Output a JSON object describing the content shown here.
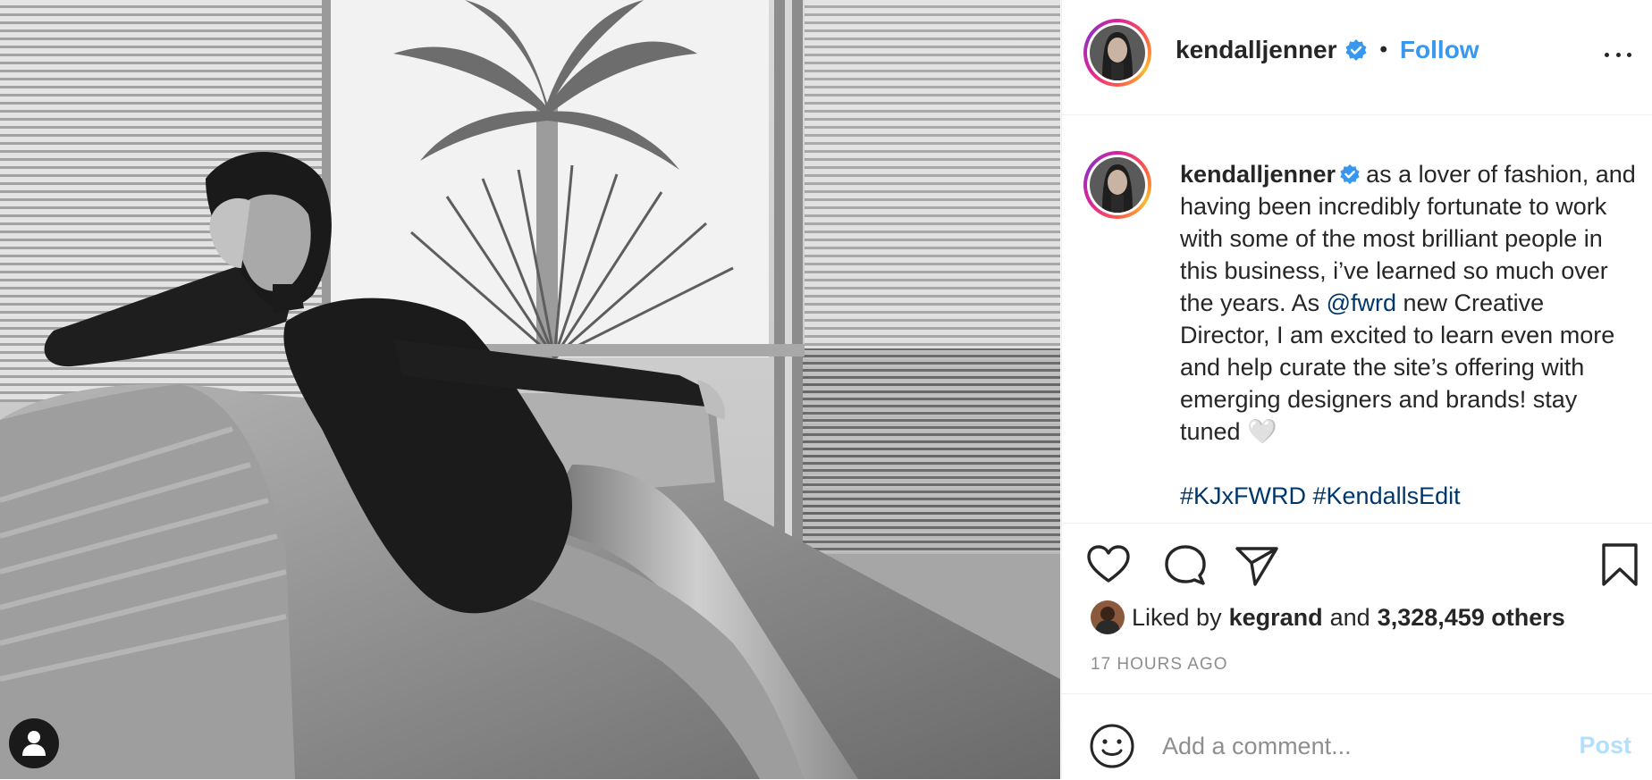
{
  "post": {
    "username": "kendalljenner",
    "follow_label": "Follow",
    "dot": "•",
    "caption_parts": {
      "p1": "as a lover of fashion, and having been incredibly fortunate to work with some of the most brilliant people in this business, i’ve learned so much over the years. As ",
      "mention": "@fwrd",
      "p2": " new Creative Director, I am excited to learn even more and help curate the site’s offering with emerging designers and brands! stay tuned 🤍"
    },
    "hashtags": [
      "#KJxFWRD",
      "#KendallsEdit"
    ],
    "likes": {
      "prefix": "Liked by",
      "user": "kegrand",
      "and": "and",
      "count": "3,328,459 others"
    },
    "timestamp": "17 HOURS AGO",
    "comment": {
      "placeholder": "Add a comment...",
      "post_label": "Post"
    }
  },
  "icons": {
    "verified": "verified-badge-icon",
    "more": "more-options-icon",
    "like": "heart-icon",
    "comment": "comment-bubble-icon",
    "share": "paper-plane-icon",
    "save": "bookmark-icon",
    "emoji": "emoji-smiley-icon",
    "tag": "user-tag-icon"
  },
  "colors": {
    "link_blue": "#3897f0",
    "mention_blue": "#00376b",
    "post_disabled": "#b2dffc",
    "verified": "#3897f0"
  }
}
